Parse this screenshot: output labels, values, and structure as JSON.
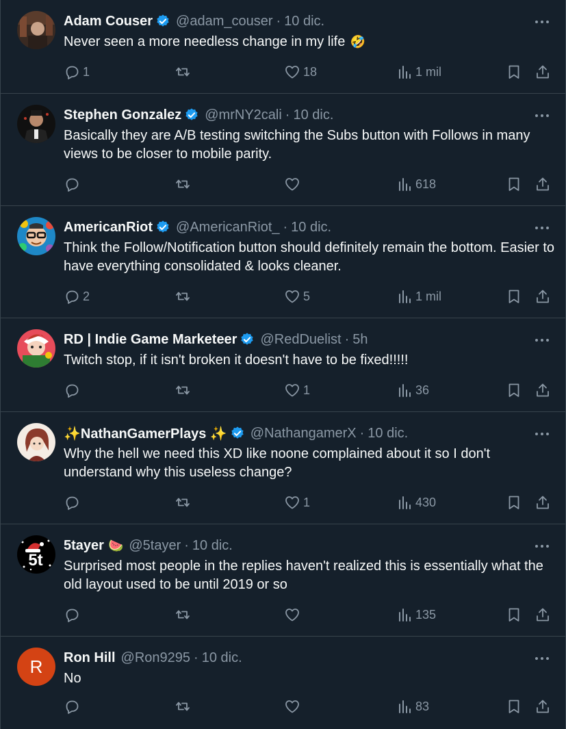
{
  "tweets": [
    {
      "name": "Adam Couser",
      "handle": "@adam_couser",
      "time": "10 dic.",
      "text": "Never seen a more needless change in my life",
      "emoji": "🤣",
      "replies": "1",
      "retweets": "",
      "likes": "18",
      "views": "1 mil",
      "avatar": "photo-man-dark-room",
      "verified": true
    },
    {
      "name": "Stephen Gonzalez",
      "handle": "@mrNY2cali",
      "time": "10 dic.",
      "text": "Basically they are A/B testing switching the Subs button with Follows in many views to be closer to mobile parity.",
      "emoji": "",
      "replies": "",
      "retweets": "",
      "likes": "",
      "views": "618",
      "avatar": "photo-man-suit",
      "verified": true
    },
    {
      "name": "AmericanRiot",
      "handle": "@AmericanRiot_",
      "time": "10 dic.",
      "text": "Think the Follow/Notification button should definitely remain the bottom. Easier to have everything consolidated & looks cleaner.",
      "emoji": "",
      "replies": "2",
      "retweets": "",
      "likes": "5",
      "views": "1 mil",
      "avatar": "cartoon-glasses-colorful",
      "verified": true
    },
    {
      "name": "RD | Indie Game Marketeer",
      "handle": "@RedDuelist",
      "time": "5h",
      "text": "Twitch stop, if it isn't broken it doesn't have to be fixed!!!!!",
      "emoji": "",
      "replies": "",
      "retweets": "",
      "likes": "1",
      "views": "36",
      "avatar": "cartoon-red-christmas",
      "verified": true
    },
    {
      "name": "✨NathanGamerPlays ✨",
      "handle": "@NathangamerX",
      "time": "10 dic.",
      "text": "Why the hell we need this XD like noone complained about it so I don't understand why this useless change?",
      "emoji": "",
      "replies": "",
      "retweets": "",
      "likes": "1",
      "views": "430",
      "avatar": "anime-character",
      "verified": true
    },
    {
      "name": "5tayer",
      "handle": "@5tayer",
      "time": "10 dic.",
      "text": "Surprised most people in the replies haven't realized this is essentially what the old layout used to be until 2019 or so",
      "emoji": "",
      "name_emoji": "🍉",
      "replies": "",
      "retweets": "",
      "likes": "",
      "views": "135",
      "avatar": "logo-5t-santa-hat",
      "verified": false
    },
    {
      "name": "Ron Hill",
      "handle": "@Ron9295",
      "time": "10 dic.",
      "text": "No",
      "emoji": "",
      "replies": "",
      "retweets": "",
      "likes": "",
      "views": "83",
      "avatar": "letter-avatar",
      "avatar_letter": "R",
      "verified": false
    }
  ],
  "colors": {
    "background": "#15202b",
    "divider": "#38444d",
    "text": "#f7f9f9",
    "muted": "#8b98a5",
    "verified": "#1d9bf0",
    "avatar_r": "#d44314"
  },
  "icons": [
    "reply-icon",
    "retweet-icon",
    "like-icon",
    "views-icon",
    "bookmark-icon",
    "share-icon",
    "more-icon",
    "verified-icon"
  ]
}
